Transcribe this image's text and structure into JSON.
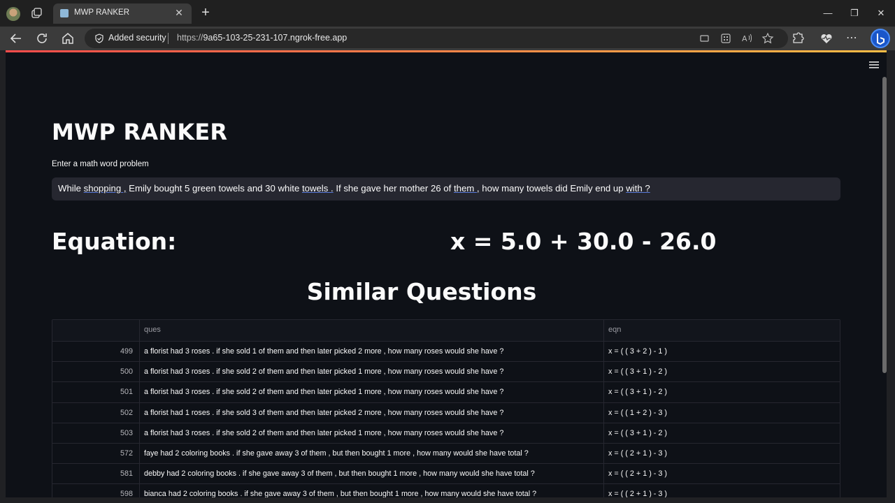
{
  "browser": {
    "tab_title": "MWP RANKER",
    "security_label": "Added security",
    "url_scheme": "https://",
    "url_host": "9a65-103-25-231-107.ngrok-free.app"
  },
  "app": {
    "title": "MWP RANKER",
    "input_label": "Enter a math word problem",
    "problem_segments": [
      {
        "text": "While ",
        "underline": false
      },
      {
        "text": "shopping ,",
        "underline": true
      },
      {
        "text": " Emily bought 5 green towels and 30 white ",
        "underline": false
      },
      {
        "text": "towels .",
        "underline": true
      },
      {
        "text": " If she gave her mother 26 of ",
        "underline": false
      },
      {
        "text": "them ,",
        "underline": true
      },
      {
        "text": " how many towels did Emily end up ",
        "underline": false
      },
      {
        "text": "with ?",
        "underline": true
      }
    ],
    "equation_label": "Equation:",
    "equation_value": "x = 5.0 + 30.0 - 26.0",
    "similar_title": "Similar Questions"
  },
  "table": {
    "columns": [
      "",
      "ques",
      "eqn"
    ],
    "rows": [
      {
        "idx": "499",
        "ques": "a florist had 3 roses . if she sold 1 of them and then later picked 2 more , how many roses would she have ?",
        "eqn": "x = ( ( 3 + 2 ) - 1 )"
      },
      {
        "idx": "500",
        "ques": "a florist had 3 roses . if she sold 2 of them and then later picked 1 more , how many roses would she have ?",
        "eqn": "x = ( ( 3 + 1 ) - 2 )"
      },
      {
        "idx": "501",
        "ques": "a florist had 3 roses . if she sold 2 of them and then later picked 1 more , how many roses would she have ?",
        "eqn": "x = ( ( 3 + 1 ) - 2 )"
      },
      {
        "idx": "502",
        "ques": "a florist had 1 roses . if she sold 3 of them and then later picked 2 more , how many roses would she have ?",
        "eqn": "x = ( ( 1 + 2 ) - 3 )"
      },
      {
        "idx": "503",
        "ques": "a florist had 3 roses . if she sold 2 of them and then later picked 1 more , how many roses would she have ?",
        "eqn": "x = ( ( 3 + 1 ) - 2 )"
      },
      {
        "idx": "572",
        "ques": "faye had 2 coloring books . if she gave away 3 of them , but then bought 1 more , how many would she have total ?",
        "eqn": "x = ( ( 2 + 1 ) - 3 )"
      },
      {
        "idx": "581",
        "ques": "debby had 2 coloring books . if she gave away 3 of them , but then bought 1 more , how many would she have total ?",
        "eqn": "x = ( ( 2 + 1 ) - 3 )"
      },
      {
        "idx": "598",
        "ques": "bianca had 2 coloring books . if she gave away 3 of them , but then bought 1 more , how many would she have total ?",
        "eqn": "x = ( ( 2 + 1 ) - 3 )"
      }
    ]
  }
}
